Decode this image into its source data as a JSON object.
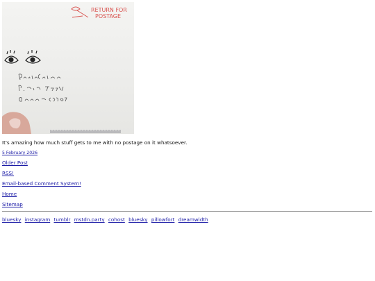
{
  "photo": {
    "stamp_text": "RETURN FOR POSTAGE",
    "address_lines": [
      "Postal Customer",
      "P.O. Box 2XXXX",
      "Denver CO 8XXXX"
    ],
    "stamp_color": "#d9534f"
  },
  "post": {
    "caption": "It's amazing how much stuff gets to me with no postage on it whatsoever.",
    "date": "5 February 2026"
  },
  "nav": {
    "older": "Older Post",
    "rss": "RSS!",
    "email": "Email-based Comment System!",
    "home": "Home",
    "sitemap": "Sitemap"
  },
  "social": [
    "bluesky",
    "instagram",
    "tumblr",
    "mstdn.party",
    "cohost",
    "bluesky",
    "pillowfort",
    "dreamwidth"
  ],
  "colors": {
    "link": "#1a1aa6",
    "text": "#111111"
  }
}
